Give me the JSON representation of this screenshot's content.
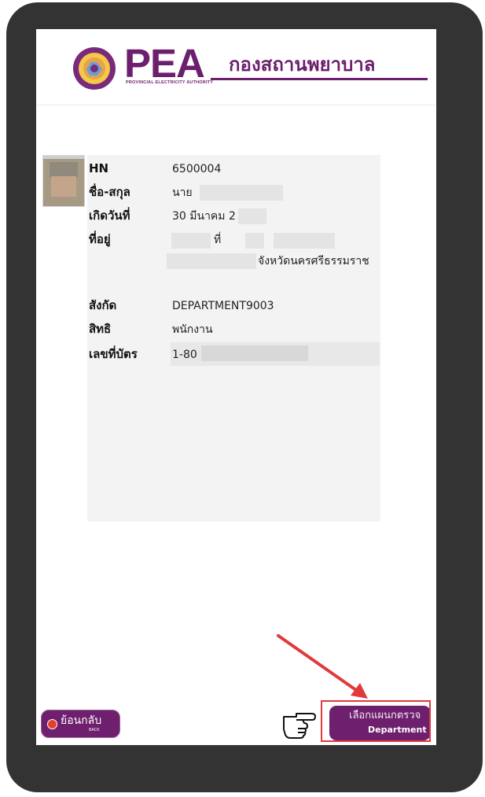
{
  "header": {
    "logo_word": "PEA",
    "logo_subtitle": "PROVINCIAL ELECTRICITY AUTHORITY",
    "hospital_name": "กองสถานพยาบาล"
  },
  "patient": {
    "hn_label": "HN",
    "hn_value": "6500004",
    "name_label": "ชื่อ-สกุล",
    "name_value": "นาย ",
    "birth_label": "เกิดวันที่",
    "birth_value": "30 มีนาคม 2",
    "address_label": "ที่อยู่",
    "address_line1": "ที่",
    "address_line2": "จังหวัดนครศรีธรรมราช",
    "dept_label": "สังกัด",
    "dept_value": "DEPARTMENT9003",
    "right_label": "สิทธิ",
    "right_value": "พนักงาน",
    "card_label": "เลขที่บัตร",
    "card_value": "1-80"
  },
  "buttons": {
    "back_label": "ย้อนกลับ",
    "back_sub": "BACK",
    "dept_label_th": "เลือกแผนกตรวจ",
    "dept_label_en": "Department"
  },
  "colors": {
    "brand": "#6e1f6d",
    "highlight": "#e03a3a",
    "frame": "#333333"
  }
}
